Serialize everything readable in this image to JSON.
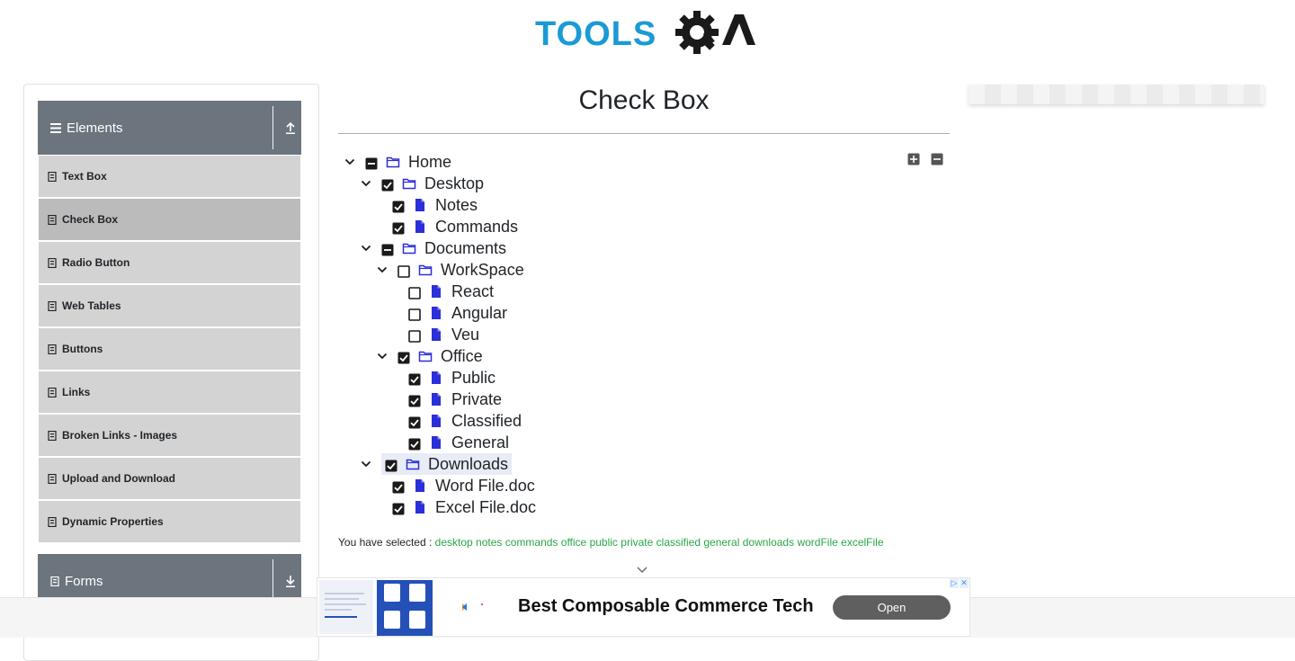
{
  "logo": {
    "text_part": "TOOLS",
    "qa_part": "QA"
  },
  "sidebar": {
    "elements_group": {
      "title": "Elements"
    },
    "items": [
      {
        "label": "Text Box"
      },
      {
        "label": "Check Box",
        "active": true
      },
      {
        "label": "Radio Button"
      },
      {
        "label": "Web Tables"
      },
      {
        "label": "Buttons"
      },
      {
        "label": "Links"
      },
      {
        "label": "Broken Links - Images"
      },
      {
        "label": "Upload and Download"
      },
      {
        "label": "Dynamic Properties"
      }
    ],
    "forms_group": {
      "title": "Forms"
    }
  },
  "main": {
    "title": "Check Box",
    "tree": [
      {
        "label": "Home",
        "type": "folder",
        "state": "partial",
        "level": 0,
        "expandable": true
      },
      {
        "label": "Desktop",
        "type": "folder",
        "state": "checked",
        "level": 1,
        "expandable": true
      },
      {
        "label": "Notes",
        "type": "file",
        "state": "checked",
        "level": 2,
        "expandable": false
      },
      {
        "label": "Commands",
        "type": "file",
        "state": "checked",
        "level": 2,
        "expandable": false
      },
      {
        "label": "Documents",
        "type": "folder",
        "state": "partial",
        "level": 1,
        "expandable": true
      },
      {
        "label": "WorkSpace",
        "type": "folder",
        "state": "unchecked",
        "level": 2,
        "expandable": true
      },
      {
        "label": "React",
        "type": "file",
        "state": "unchecked",
        "level": 3,
        "expandable": false
      },
      {
        "label": "Angular",
        "type": "file",
        "state": "unchecked",
        "level": 3,
        "expandable": false
      },
      {
        "label": "Veu",
        "type": "file",
        "state": "unchecked",
        "level": 3,
        "expandable": false
      },
      {
        "label": "Office",
        "type": "folder",
        "state": "checked",
        "level": 2,
        "expandable": true
      },
      {
        "label": "Public",
        "type": "file",
        "state": "checked",
        "level": 3,
        "expandable": false
      },
      {
        "label": "Private",
        "type": "file",
        "state": "checked",
        "level": 3,
        "expandable": false
      },
      {
        "label": "Classified",
        "type": "file",
        "state": "checked",
        "level": 3,
        "expandable": false
      },
      {
        "label": "General",
        "type": "file",
        "state": "checked",
        "level": 3,
        "expandable": false
      },
      {
        "label": "Downloads",
        "type": "folder",
        "state": "checked",
        "level": 1,
        "expandable": true,
        "highlighted": true
      },
      {
        "label": "Word File.doc",
        "type": "file",
        "state": "checked",
        "level": 2,
        "expandable": false
      },
      {
        "label": "Excel File.doc",
        "type": "file",
        "state": "checked",
        "level": 2,
        "expandable": false
      }
    ],
    "result": {
      "prefix": "You have selected :",
      "selected": [
        "desktop",
        "notes",
        "commands",
        "office",
        "public",
        "private",
        "classified",
        "general",
        "downloads",
        "wordFile",
        "excelFile"
      ]
    }
  },
  "ad": {
    "headline": "Best Composable Commerce Tech",
    "open_label": "Open"
  },
  "colors": {
    "brand_blue": "#1a9ad6",
    "folder_blue": "#2b2fd9",
    "selected_green": "#28a745",
    "sidebar_header": "#6c757d"
  }
}
